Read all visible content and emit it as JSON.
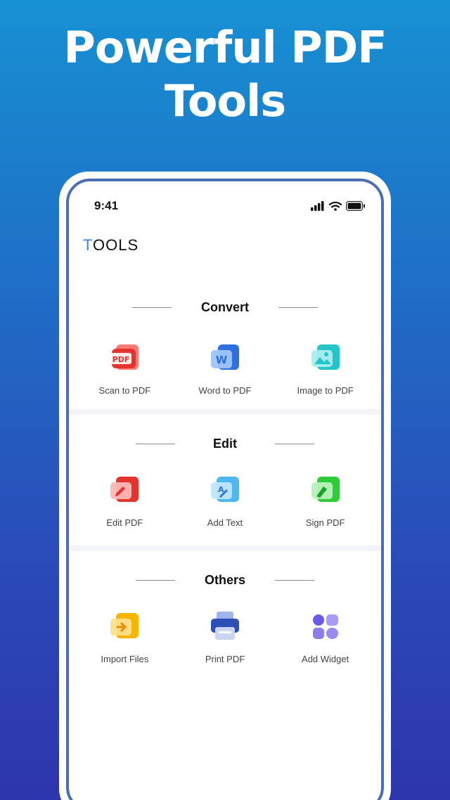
{
  "headline": {
    "line1": "Powerful PDF",
    "line2": "Tools"
  },
  "status": {
    "time": "9:41"
  },
  "app": {
    "title_first": "T",
    "title_rest": "OOLS"
  },
  "sections": [
    {
      "title": "Convert",
      "tools": [
        {
          "label": "Scan to PDF",
          "icon": "pdf-scan-icon"
        },
        {
          "label": "Word to PDF",
          "icon": "word-icon"
        },
        {
          "label": "Image to PDF",
          "icon": "image-icon"
        }
      ]
    },
    {
      "title": "Edit",
      "tools": [
        {
          "label": "Edit PDF",
          "icon": "edit-pdf-icon"
        },
        {
          "label": "Add Text",
          "icon": "add-text-icon"
        },
        {
          "label": "Sign PDF",
          "icon": "sign-pdf-icon"
        }
      ]
    },
    {
      "title": "Others",
      "tools": [
        {
          "label": "Import Files",
          "icon": "import-icon"
        },
        {
          "label": "Print PDF",
          "icon": "printer-icon"
        },
        {
          "label": "Add Widget",
          "icon": "widget-icon"
        }
      ]
    }
  ],
  "colors": {
    "accent": "#3a86e0",
    "pdf_red": "#e3342f",
    "word_blue": "#2f6fe0",
    "image_teal": "#24c4c8",
    "sign_green": "#2fcc3a",
    "import_yellow": "#f7b500",
    "print_blue": "#2c4fb8",
    "widget_purple": "#7a63f0"
  }
}
